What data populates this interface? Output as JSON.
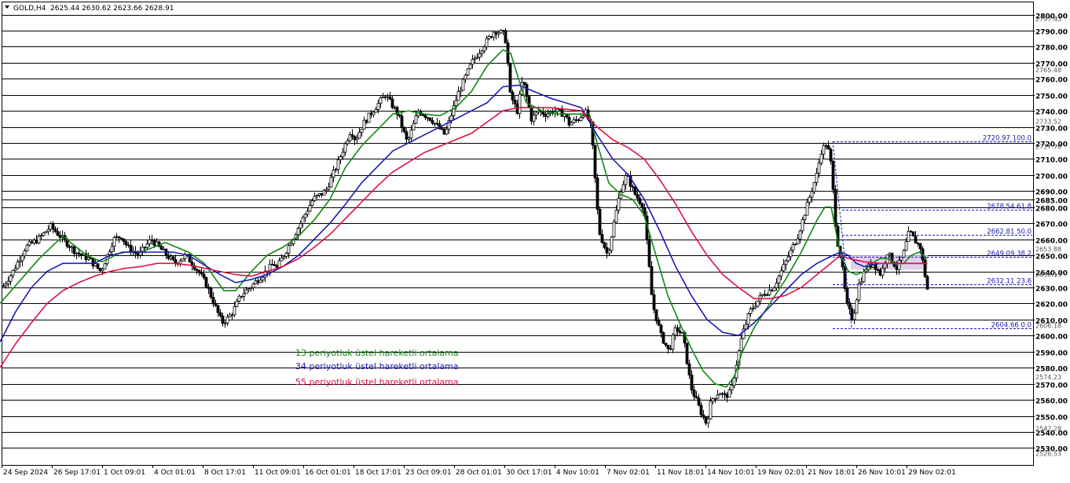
{
  "header": {
    "symbol": "GOLD,H4",
    "ohlc": "2625.44 2630.62 2623.66 2628.91"
  },
  "colors": {
    "background": "#ffffff",
    "grid": "#000000",
    "candle": "#000000",
    "ema13": "#118811",
    "ema34": "#1a1ab8",
    "ema55": "#dd1144",
    "fib_line": "#1a1ab8",
    "fib_zone": "#dcc8e6"
  },
  "legend": [
    {
      "key": "ema13",
      "label": "13 periyotluk üstel hareketli ortalama",
      "color": "#118811"
    },
    {
      "key": "ema34",
      "label": "34 periyotluk üstel hareketli ortalama",
      "color": "#1a1ab8"
    },
    {
      "key": "ema55",
      "label": "55 periyotluk üstel hareketli ortalama",
      "color": "#dd1144"
    }
  ],
  "chart_data": {
    "type": "line",
    "ylim": [
      2526.53,
      2800.0
    ],
    "y_ticks": [
      "2800.00",
      "2790.00",
      "2780.00",
      "2770.00",
      "2760.00",
      "2750.00",
      "2740.00",
      "2730.00",
      "2720.00",
      "2710.00",
      "2700.00",
      "2690.00",
      "2685.00",
      "2680.00",
      "2670.00",
      "2660.00",
      "2650.00",
      "2640.00",
      "2630.00",
      "2620.00",
      "2610.00",
      "2600.00",
      "2590.00",
      "2580.00",
      "2570.00",
      "2560.00",
      "2550.00",
      "2540.00",
      "2530.00"
    ],
    "y_tick_values": [
      2800,
      2790,
      2780,
      2770,
      2760,
      2750,
      2740,
      2730,
      2720,
      2710,
      2700,
      2690,
      2685,
      2680,
      2670,
      2660,
      2650,
      2640,
      2630,
      2620,
      2610,
      2600,
      2590,
      2580,
      2570,
      2560,
      2550,
      2540,
      2530
    ],
    "y_extra_labels": [
      {
        "text": "2797.43",
        "value": 2797.43
      },
      {
        "text": "2765.48",
        "value": 2765.48
      },
      {
        "text": "2733.52",
        "value": 2733.52
      },
      {
        "text": "2717.78",
        "value": 2717.78
      },
      {
        "text": "2653.88",
        "value": 2653.88
      },
      {
        "text": "2638.13",
        "value": 2638.13
      },
      {
        "text": "2606.18",
        "value": 2606.18
      },
      {
        "text": "2574.23",
        "value": 2574.23
      },
      {
        "text": "2542.28",
        "value": 2542.28
      },
      {
        "text": "2526.53",
        "value": 2526.53
      }
    ],
    "x_labels": [
      "24 Sep 2024",
      "26 Sep 17:01",
      "1 Oct 09:01",
      "4 Oct 01:01",
      "8 Oct 17:01",
      "11 Oct 09:01",
      "16 Oct 01:01",
      "18 Oct 17:01",
      "23 Oct 09:01",
      "28 Oct 01:01",
      "30 Oct 17:01",
      "4 Nov 10:01",
      "7 Nov 02:01",
      "11 Nov 18:01",
      "14 Nov 10:01",
      "19 Nov 02:01",
      "21 Nov 18:01",
      "26 Nov 10:01",
      "29 Nov 02:01"
    ],
    "price_anchors": {
      "x": [
        0,
        16,
        32,
        48,
        64,
        80,
        96,
        112,
        128,
        144,
        154,
        162,
        176,
        192,
        208,
        222,
        236,
        252,
        262,
        282,
        288,
        296,
        306,
        322,
        338,
        348,
        352,
        366,
        382,
        398,
        414,
        430,
        446,
        452,
        462,
        474,
        490,
        506,
        518,
        532,
        548,
        566,
        582,
        600,
        614,
        629,
        641,
        644,
        649,
        658,
        665,
        676,
        685,
        694,
        704,
        718,
        724,
        736,
        744,
        752,
        762,
        773,
        789,
        797,
        808,
        819,
        830,
        841,
        851,
        860,
        869,
        879,
        892,
        899,
        905,
        915,
        922,
        930,
        938,
        944,
        954,
        969,
        984,
        999,
        1015,
        1025,
        1031,
        1039,
        1045,
        1052,
        1058,
        1062,
        1065,
        1071,
        1077,
        1085,
        1093,
        1102,
        1111,
        1121,
        1129,
        1141,
        1149,
        1157,
        1163,
        1171,
        1180
      ],
      "close": [
        2628,
        2640,
        2655,
        2660,
        2668,
        2660,
        2652,
        2648,
        2640,
        2660,
        2662,
        2655,
        2650,
        2660,
        2652,
        2645,
        2650,
        2640,
        2632,
        2608,
        2610,
        2615,
        2625,
        2632,
        2640,
        2645,
        2642,
        2655,
        2670,
        2685,
        2690,
        2708,
        2728,
        2722,
        2732,
        2740,
        2750,
        2738,
        2720,
        2740,
        2735,
        2725,
        2750,
        2770,
        2780,
        2790,
        2788,
        2782,
        2750,
        2740,
        2760,
        2735,
        2740,
        2738,
        2740,
        2738,
        2732,
        2735,
        2740,
        2730,
        2665,
        2650,
        2690,
        2700,
        2688,
        2680,
        2620,
        2600,
        2590,
        2605,
        2600,
        2568,
        2552,
        2545,
        2560,
        2565,
        2562,
        2565,
        2585,
        2600,
        2615,
        2625,
        2630,
        2645,
        2662,
        2678,
        2688,
        2700,
        2715,
        2720,
        2705,
        2675,
        2660,
        2645,
        2620,
        2610,
        2632,
        2642,
        2645,
        2638,
        2652,
        2642,
        2650,
        2665,
        2660,
        2655,
        2628.91
      ]
    },
    "series": [
      {
        "name": "13 periyotluk üstel hareketli ortalama",
        "x": [
          0,
          50,
          80,
          110,
          130,
          155,
          180,
          210,
          240,
          260,
          285,
          300,
          320,
          340,
          360,
          380,
          400,
          420,
          440,
          460,
          480,
          500,
          520,
          540,
          560,
          580,
          600,
          620,
          640,
          650,
          660,
          670,
          690,
          710,
          730,
          750,
          760,
          775,
          790,
          805,
          820,
          835,
          850,
          865,
          880,
          895,
          910,
          925,
          935,
          945,
          960,
          980,
          1000,
          1020,
          1040,
          1050,
          1058,
          1062,
          1070,
          1080,
          1090,
          1100,
          1110,
          1120,
          1130,
          1140,
          1150,
          1160,
          1170,
          1180
        ],
        "values": [
          2620,
          2648,
          2662,
          2650,
          2646,
          2652,
          2652,
          2658,
          2652,
          2645,
          2628,
          2628,
          2640,
          2650,
          2655,
          2662,
          2672,
          2685,
          2705,
          2718,
          2728,
          2738,
          2740,
          2738,
          2737,
          2742,
          2752,
          2768,
          2778,
          2776,
          2760,
          2745,
          2740,
          2738,
          2738,
          2738,
          2720,
          2695,
          2688,
          2685,
          2675,
          2650,
          2625,
          2608,
          2592,
          2578,
          2570,
          2568,
          2575,
          2590,
          2605,
          2620,
          2635,
          2652,
          2672,
          2680,
          2680,
          2670,
          2650,
          2640,
          2638,
          2640,
          2645,
          2648,
          2648,
          2645,
          2645,
          2650,
          2652,
          2648
        ]
      },
      {
        "name": "34 periyotluk üstel hareketli ortalama",
        "x": [
          0,
          20,
          40,
          60,
          80,
          100,
          120,
          140,
          160,
          180,
          200,
          220,
          240,
          260,
          280,
          300,
          320,
          340,
          360,
          380,
          400,
          420,
          440,
          460,
          480,
          500,
          520,
          540,
          560,
          580,
          600,
          620,
          640,
          660,
          680,
          700,
          720,
          740,
          760,
          780,
          800,
          820,
          840,
          860,
          880,
          900,
          920,
          940,
          960,
          980,
          1000,
          1020,
          1040,
          1060,
          1070,
          1080,
          1090,
          1100,
          1120,
          1140,
          1160,
          1180
        ],
        "values": [
          2596,
          2615,
          2630,
          2640,
          2645,
          2645,
          2645,
          2650,
          2652,
          2652,
          2652,
          2652,
          2650,
          2644,
          2638,
          2633,
          2635,
          2638,
          2643,
          2650,
          2660,
          2670,
          2682,
          2695,
          2705,
          2715,
          2720,
          2725,
          2730,
          2735,
          2740,
          2745,
          2755,
          2756,
          2752,
          2748,
          2745,
          2742,
          2725,
          2710,
          2700,
          2685,
          2665,
          2643,
          2625,
          2610,
          2602,
          2600,
          2608,
          2618,
          2628,
          2638,
          2645,
          2650,
          2652,
          2650,
          2645,
          2643,
          2645,
          2645,
          2645,
          2645
        ]
      },
      {
        "name": "55 periyotluk üstel hareketli ortalama",
        "x": [
          0,
          20,
          40,
          60,
          80,
          100,
          120,
          140,
          160,
          180,
          200,
          220,
          240,
          260,
          280,
          300,
          320,
          340,
          360,
          380,
          400,
          420,
          440,
          460,
          480,
          500,
          520,
          540,
          560,
          580,
          600,
          620,
          640,
          660,
          680,
          700,
          720,
          740,
          760,
          780,
          800,
          820,
          840,
          860,
          880,
          900,
          920,
          940,
          960,
          980,
          1000,
          1020,
          1040,
          1060,
          1070,
          1080,
          1100,
          1120,
          1140,
          1160,
          1180
        ],
        "values": [
          2580,
          2595,
          2608,
          2620,
          2628,
          2633,
          2637,
          2640,
          2642,
          2643,
          2645,
          2645,
          2644,
          2642,
          2640,
          2638,
          2637,
          2640,
          2643,
          2648,
          2655,
          2663,
          2673,
          2683,
          2693,
          2702,
          2708,
          2714,
          2718,
          2722,
          2726,
          2733,
          2740,
          2742,
          2742,
          2742,
          2741,
          2740,
          2730,
          2722,
          2717,
          2710,
          2697,
          2682,
          2665,
          2650,
          2638,
          2630,
          2623,
          2623,
          2625,
          2630,
          2638,
          2646,
          2650,
          2648,
          2646,
          2645,
          2645,
          2645,
          2645
        ]
      }
    ],
    "fibonacci": {
      "levels": [
        {
          "label": "2720.97 100.0",
          "value": 2720.97
        },
        {
          "label": "2678.54 61.8",
          "value": 2678.54
        },
        {
          "label": "2662.81 50.0",
          "value": 2662.81
        },
        {
          "label": "2649.09 38.2",
          "value": 2649.09
        },
        {
          "label": "2632.11 23.6",
          "value": 2632.11
        },
        {
          "label": "2604.66 0.0",
          "value": 2604.66
        }
      ],
      "zone": [
        2641.0,
        2650.0
      ]
    }
  }
}
